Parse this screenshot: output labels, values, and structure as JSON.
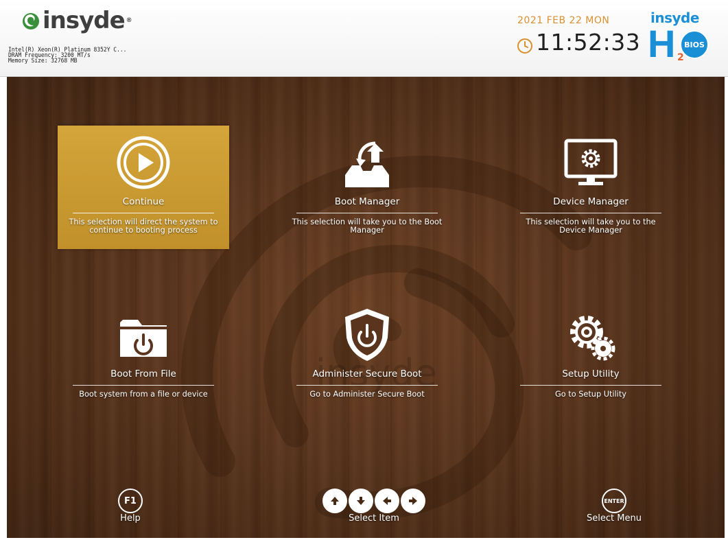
{
  "header": {
    "brand_name": "insyde",
    "brand_tm": "®",
    "sysinfo": [
      "Intel(R) Xeon(R) Platinum 8352Y C...",
      "DRAM Frequency: 3200 MT/s",
      "Memory Size: 32768 MB"
    ],
    "date": "2021 FEB 22 MON",
    "time": "11:52:33",
    "logo": {
      "word": "insyde",
      "letter": "H",
      "subscript": "2",
      "badge": "BIOS"
    }
  },
  "tiles": [
    {
      "label": "Continue",
      "description": "This selection will direct the system to continue to booting process",
      "icon": "play-circle-icon",
      "selected": true
    },
    {
      "label": "Boot Manager",
      "description": "This selection will take you to the Boot Manager",
      "icon": "boot-tray-icon",
      "selected": false
    },
    {
      "label": "Device Manager",
      "description": "This selection will take you to the Device Manager",
      "icon": "monitor-gear-icon",
      "selected": false
    },
    {
      "label": "Boot From File",
      "description": "Boot system from a file or device",
      "icon": "folder-power-icon",
      "selected": false
    },
    {
      "label": "Administer Secure Boot",
      "description": "Go to Administer Secure Boot",
      "icon": "shield-power-icon",
      "selected": false
    },
    {
      "label": "Setup Utility",
      "description": "Go to Setup Utility",
      "icon": "gears-icon",
      "selected": false
    }
  ],
  "footer": {
    "help": {
      "key": "F1",
      "label": "Help"
    },
    "select_item": {
      "label": "Select Item",
      "keys": [
        "up-arrow-icon",
        "down-arrow-icon",
        "left-arrow-icon",
        "right-arrow-icon"
      ]
    },
    "select_menu": {
      "key": "ENTER",
      "label": "Select Menu"
    }
  },
  "colors": {
    "selected_tile": "#c9982f",
    "date_accent": "#d99030",
    "logo_blue": "#1a8fd6",
    "logo_orange": "#e0612b"
  }
}
